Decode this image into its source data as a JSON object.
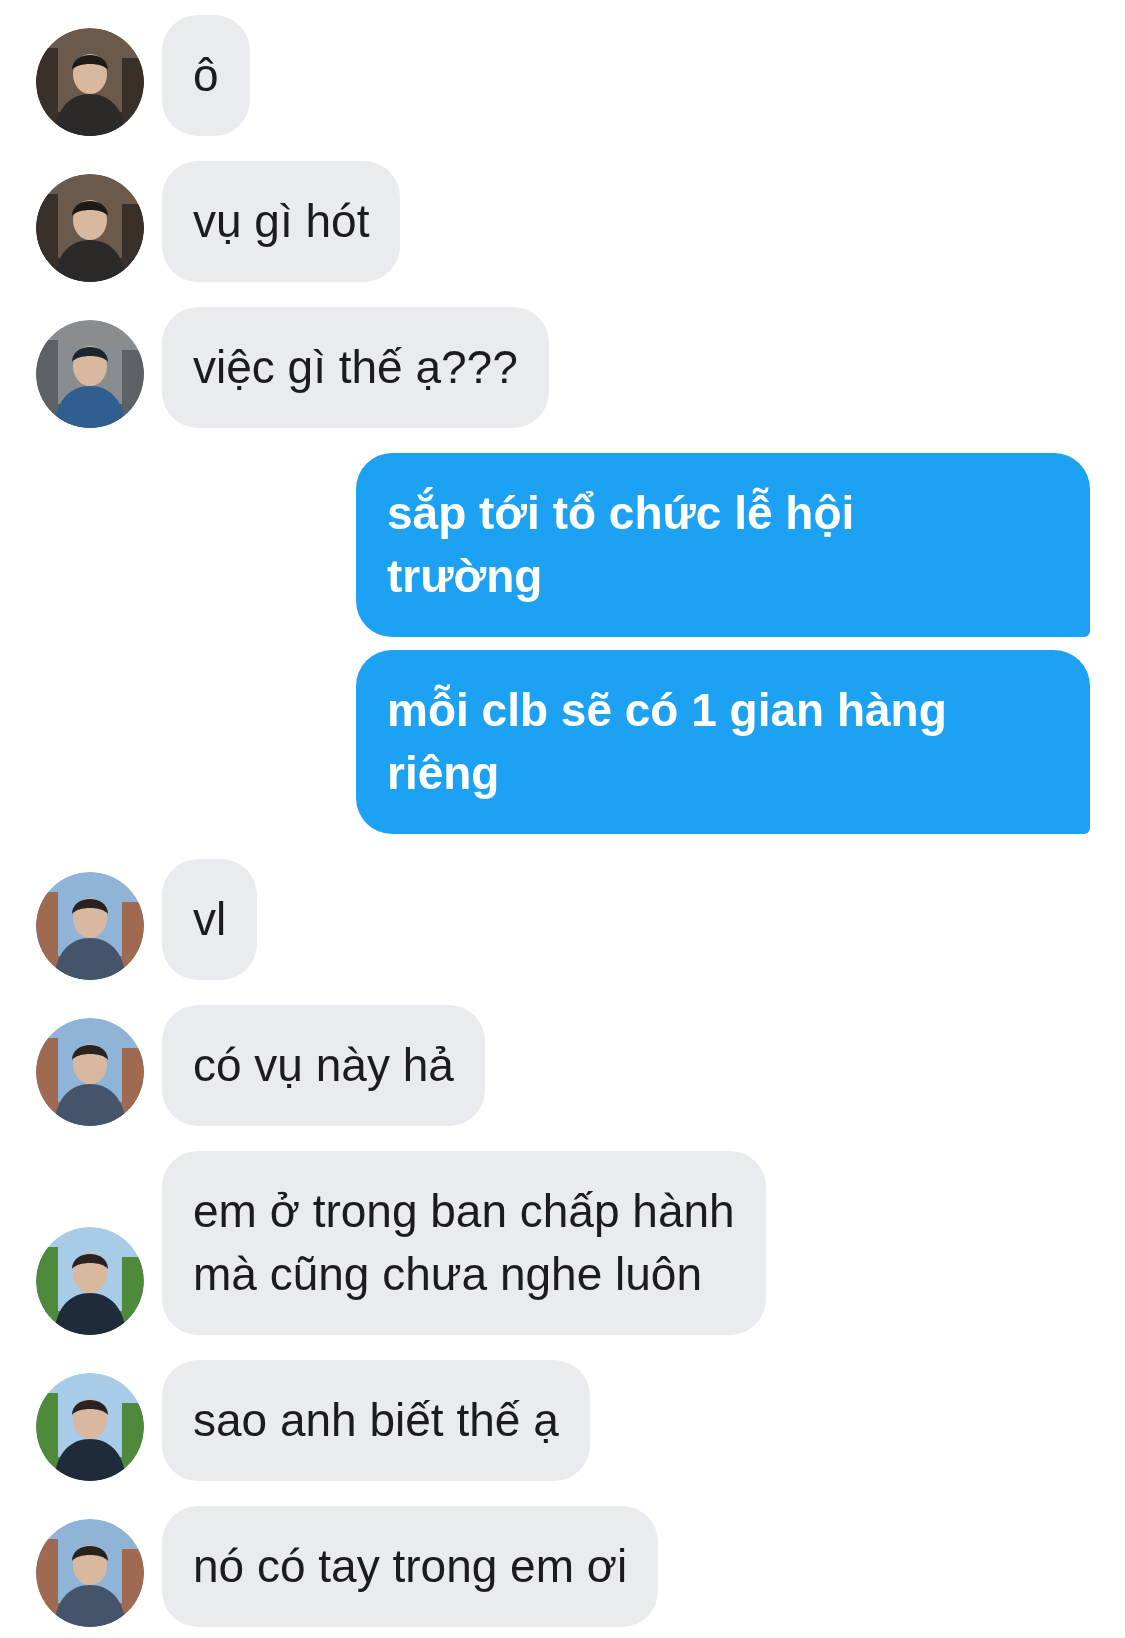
{
  "messages": [
    {
      "kind": "incoming",
      "avatar": {
        "kind": "picture"
      },
      "lines": [
        "ô"
      ]
    },
    {
      "kind": "incoming",
      "avatar": {
        "kind": "picture"
      },
      "lines": [
        "vụ gì hót"
      ]
    },
    {
      "kind": "incoming",
      "avatar": {
        "kind": "picture"
      },
      "lines": [
        "việc gì thế ạ???"
      ]
    },
    {
      "kind": "outgoing",
      "lines": [
        "sắp tới tổ chức lễ hội",
        "trường"
      ]
    },
    {
      "kind": "outgoing",
      "lines": [
        "mỗi clb sẽ có 1 gian hàng",
        "riêng"
      ]
    },
    {
      "kind": "incoming",
      "avatar": {
        "kind": "picture"
      },
      "lines": [
        "vl"
      ]
    },
    {
      "kind": "incoming",
      "avatar": {
        "kind": "picture"
      },
      "lines": [
        "có vụ này hả"
      ]
    },
    {
      "kind": "incoming",
      "avatar": {
        "kind": "picture"
      },
      "lines": [
        "em ở trong ban chấp hành",
        "mà cũng chưa nghe luôn"
      ]
    },
    {
      "kind": "incoming",
      "avatar": {
        "kind": "picture"
      },
      "lines": [
        "sao anh biết thế ạ"
      ]
    },
    {
      "kind": "incoming",
      "avatar": {
        "kind": "picture"
      },
      "lines": [
        "nó có tay trong em ơi"
      ]
    }
  ]
}
